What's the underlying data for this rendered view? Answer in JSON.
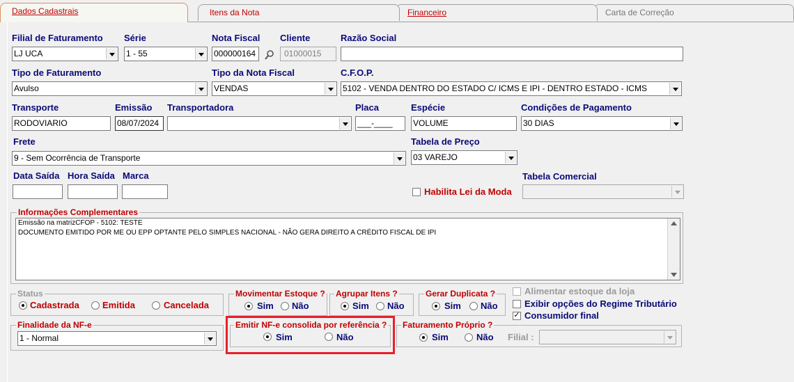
{
  "tabs": [
    {
      "label": "Dados Cadastrais"
    },
    {
      "label": "Itens da Nota"
    },
    {
      "label": "Financeiro"
    },
    {
      "label": "Carta de Correção"
    }
  ],
  "fields": {
    "filial": {
      "label": "Filial de Faturamento",
      "value": "LJ UCA"
    },
    "serie": {
      "label": "Série",
      "value": "1 - 55"
    },
    "nota_fiscal": {
      "label": "Nota Fiscal",
      "value": "000000164"
    },
    "cliente": {
      "label": "Cliente",
      "value": "01000015"
    },
    "razao_social": {
      "label": "Razão Social",
      "value": ""
    },
    "tipo_faturamento": {
      "label": "Tipo de Faturamento",
      "value": "Avulso"
    },
    "tipo_nota": {
      "label": "Tipo da Nota Fiscal",
      "value": "VENDAS"
    },
    "cfop": {
      "label": "C.F.O.P.",
      "value": "5102 - VENDA DENTRO DO ESTADO C/ ICMS E IPI - DENTRO ESTADO - ICMS"
    },
    "transporte": {
      "label": "Transporte",
      "value": "RODOVIARIO"
    },
    "emissao": {
      "label": "Emissão",
      "value": "08/07/2024"
    },
    "transportadora": {
      "label": "Transportadora",
      "value": ""
    },
    "placa": {
      "label": "Placa",
      "value": "___-____"
    },
    "especie": {
      "label": "Espécie",
      "value": "VOLUME"
    },
    "condicoes": {
      "label": "Condições de Pagamento",
      "value": "30 DIAS"
    },
    "frete": {
      "label": "Frete",
      "value": "9 - Sem Ocorrência de Transporte"
    },
    "tabela_preco": {
      "label": "Tabela de Preço",
      "value": "03 VAREJO"
    },
    "data_saida": {
      "label": "Data Saída",
      "value": ""
    },
    "hora_saida": {
      "label": "Hora Saída",
      "value": ""
    },
    "marca": {
      "label": "Marca",
      "value": ""
    },
    "habilita_lei": {
      "label": "Habilita Lei da Moda",
      "checked": false
    },
    "tabela_comercial": {
      "label": "Tabela Comercial",
      "value": ""
    }
  },
  "info": {
    "title": "Informações Complementares",
    "lines": [
      "Emissão na matrizCFOP - 5102: TESTE",
      "DOCUMENTO EMITIDO POR ME OU EPP OPTANTE PELO SIMPLES NACIONAL - NÃO GERA DIREITO A CRÉDITO FISCAL DE IPI"
    ]
  },
  "status": {
    "title": "Status",
    "options": [
      "Cadastrada",
      "Emitida",
      "Cancelada"
    ],
    "selected": "Cadastrada"
  },
  "movimentar": {
    "title": "Movimentar Estoque ?",
    "yes": "Sim",
    "no": "Não",
    "selected": "Sim"
  },
  "agrupar": {
    "title": "Agrupar Itens ?",
    "yes": "Sim",
    "no": "Não",
    "selected": "Sim"
  },
  "gerar": {
    "title": "Gerar Duplicata ?",
    "yes": "Sim",
    "no": "Não",
    "selected": "Sim"
  },
  "checks": {
    "alimentar": {
      "label": "Alimentar estoque da loja",
      "checked": false,
      "enabled": false
    },
    "exibir": {
      "label": "Exibir opções do Regime Tributário",
      "checked": false
    },
    "consumidor": {
      "label": "Consumidor final",
      "checked": true,
      "mark": "✓"
    }
  },
  "finalidade": {
    "title": "Finalidade da NF-e",
    "value": "1 - Normal"
  },
  "emitir": {
    "title": "Emitir NF-e consolida por referência ?",
    "yes": "Sim",
    "no": "Não",
    "selected": "Sim"
  },
  "faturamento": {
    "title": "Faturamento Próprio ?",
    "yes": "Sim",
    "no": "Não",
    "selected": "Sim",
    "filial_label": "Filial :",
    "filial_value": ""
  },
  "colors": {
    "highlight": "#e8202a",
    "label": "#0a0a78",
    "red_label": "#c00000"
  }
}
